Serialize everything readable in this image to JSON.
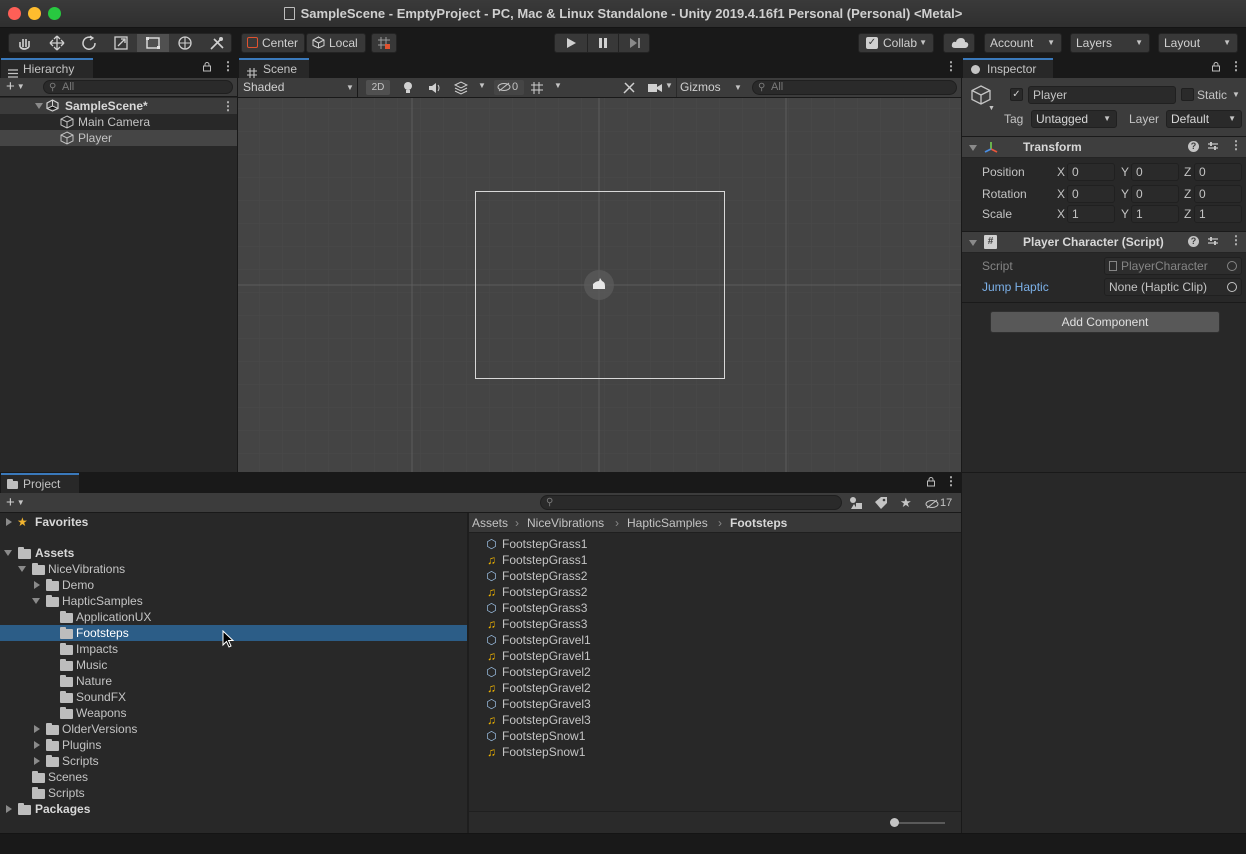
{
  "window": {
    "title": "SampleScene - EmptyProject - PC, Mac & Linux Standalone - Unity 2019.4.16f1 Personal (Personal) <Metal>"
  },
  "toolbar": {
    "pivot_label": "Center",
    "space_label": "Local",
    "collab_label": "Collab",
    "account_label": "Account",
    "layers_label": "Layers",
    "layout_label": "Layout"
  },
  "hierarchy": {
    "tab_label": "Hierarchy",
    "search_placeholder": "All",
    "scene_name": "SampleScene*",
    "items": [
      {
        "label": "Main Camera"
      },
      {
        "label": "Player"
      }
    ]
  },
  "scene": {
    "tab_label": "Scene",
    "draw_mode": "Shaded",
    "mode_2d": "2D",
    "hidden_count": "0",
    "gizmos_label": "Gizmos",
    "search_placeholder": "All"
  },
  "inspector": {
    "tab_label": "Inspector",
    "object_name": "Player",
    "static_label": "Static",
    "tag_label": "Tag",
    "tag_value": "Untagged",
    "layer_label": "Layer",
    "layer_value": "Default",
    "transform": {
      "title": "Transform",
      "rows": [
        {
          "label": "Position",
          "x": "0",
          "y": "0",
          "z": "0"
        },
        {
          "label": "Rotation",
          "x": "0",
          "y": "0",
          "z": "0"
        },
        {
          "label": "Scale",
          "x": "1",
          "y": "1",
          "z": "1"
        }
      ],
      "axis_x": "X",
      "axis_y": "Y",
      "axis_z": "Z"
    },
    "script_component": {
      "title": "Player Character (Script)",
      "script_label": "Script",
      "script_value": "PlayerCharacter",
      "jump_label": "Jump Haptic",
      "jump_value": "None (Haptic Clip)"
    },
    "add_component_label": "Add Component"
  },
  "project": {
    "tab_label": "Project",
    "hidden_count": "17",
    "favorites_label": "Favorites",
    "tree": [
      {
        "label": "Assets"
      },
      {
        "label": "NiceVibrations"
      },
      {
        "label": "Demo"
      },
      {
        "label": "HapticSamples"
      },
      {
        "label": "ApplicationUX"
      },
      {
        "label": "Footsteps"
      },
      {
        "label": "Impacts"
      },
      {
        "label": "Music"
      },
      {
        "label": "Nature"
      },
      {
        "label": "SoundFX"
      },
      {
        "label": "Weapons"
      },
      {
        "label": "OlderVersions"
      },
      {
        "label": "Plugins"
      },
      {
        "label": "Scripts"
      },
      {
        "label": "Scenes"
      },
      {
        "label": "Scripts"
      },
      {
        "label": "Packages"
      }
    ],
    "breadcrumb": [
      "Assets",
      "NiceVibrations",
      "HapticSamples",
      "Footsteps"
    ],
    "assets": [
      {
        "label": "FootstepGrass1",
        "icon": "haptic-icon"
      },
      {
        "label": "FootstepGrass1",
        "icon": "audio-icon"
      },
      {
        "label": "FootstepGrass2",
        "icon": "haptic-icon"
      },
      {
        "label": "FootstepGrass2",
        "icon": "audio-icon"
      },
      {
        "label": "FootstepGrass3",
        "icon": "haptic-icon"
      },
      {
        "label": "FootstepGrass3",
        "icon": "audio-icon"
      },
      {
        "label": "FootstepGravel1",
        "icon": "haptic-icon"
      },
      {
        "label": "FootstepGravel1",
        "icon": "audio-icon"
      },
      {
        "label": "FootstepGravel2",
        "icon": "haptic-icon"
      },
      {
        "label": "FootstepGravel2",
        "icon": "audio-icon"
      },
      {
        "label": "FootstepGravel3",
        "icon": "haptic-icon"
      },
      {
        "label": "FootstepGravel3",
        "icon": "audio-icon"
      },
      {
        "label": "FootstepSnow1",
        "icon": "haptic-icon"
      },
      {
        "label": "FootstepSnow1",
        "icon": "audio-icon"
      }
    ]
  },
  "colors": {
    "accent": "#3a79bb",
    "selection": "#2c5d87",
    "link": "#7cb1e9",
    "audio": "#f0b400"
  }
}
